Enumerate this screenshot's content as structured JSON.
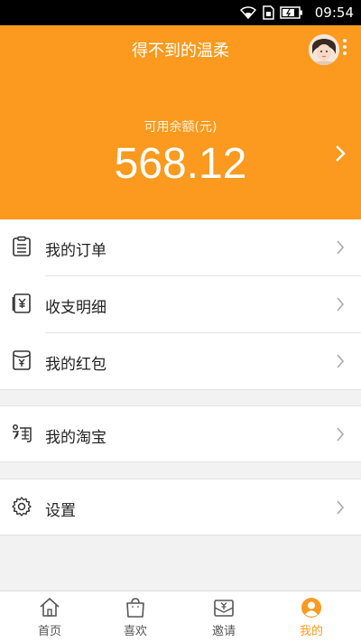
{
  "status_bar": {
    "time": "09:54"
  },
  "header": {
    "title": "得不到的温柔",
    "balance_label": "可用余额(元)",
    "balance_value": "568.12"
  },
  "menu": {
    "orders": "我的订单",
    "transactions": "收支明细",
    "red_packets": "我的红包",
    "taobao": "我的淘宝",
    "settings": "设置"
  },
  "tabs": [
    {
      "label": "首页",
      "icon": "home-icon"
    },
    {
      "label": "喜欢",
      "icon": "bag-icon"
    },
    {
      "label": "邀请",
      "icon": "envelope-icon"
    },
    {
      "label": "我的",
      "icon": "user-icon",
      "active": true
    }
  ],
  "colors": {
    "accent": "#fb9a1f",
    "background": "#f2f2f2"
  }
}
